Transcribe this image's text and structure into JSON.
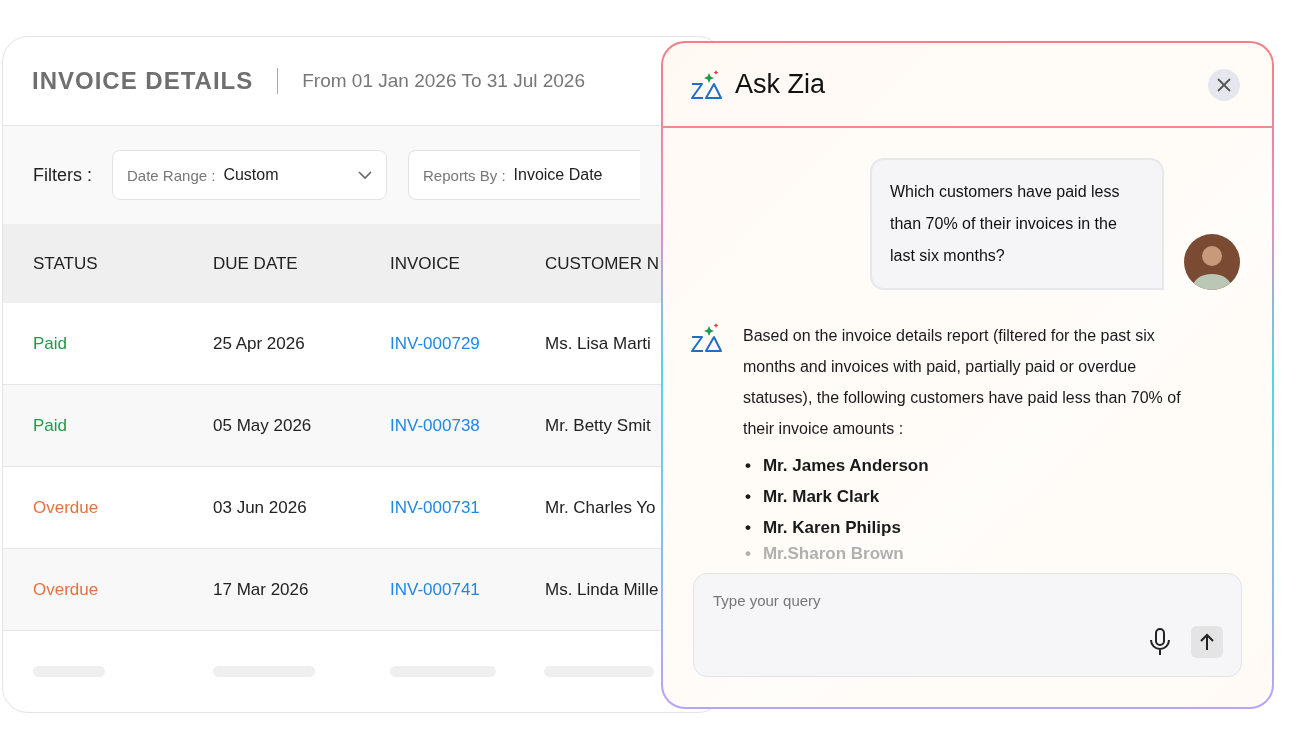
{
  "report": {
    "title": "INVOICE DETAILS",
    "date_range": "From 01 Jan 2026 To 31 Jul 2026",
    "filters_label": "Filters :",
    "filters": [
      {
        "label": "Date Range :",
        "value": "Custom",
        "show_caret": true
      },
      {
        "label": "Reports By :",
        "value": "Invoice  Date",
        "show_caret": false
      }
    ]
  },
  "table": {
    "columns": [
      "STATUS",
      "DUE DATE",
      "INVOICE",
      "CUSTOMER N"
    ],
    "rows": [
      {
        "status": "Paid",
        "color": "#1e9a4a",
        "due_date": "25 Apr 2026",
        "invoice": "INV-000729",
        "customer": "Ms. Lisa Marti"
      },
      {
        "status": "Paid",
        "color": "#1e9a4a",
        "due_date": "05 May 2026",
        "invoice": "INV-000738",
        "customer": "Mr. Betty Smit"
      },
      {
        "status": "Overdue",
        "color": "#e8703f",
        "due_date": "03 Jun 2026",
        "invoice": "INV-000731",
        "customer": "Mr. Charles Yo"
      },
      {
        "status": "Overdue",
        "color": "#e8703f",
        "due_date": "17 Mar 2026",
        "invoice": "INV-000741",
        "customer": "Ms. Linda Mille"
      }
    ]
  },
  "chat": {
    "title": "Ask Zia",
    "messages": [
      {
        "kind": "user",
        "text": "Which customers have paid less than 70% of their invoices in the last six months?"
      },
      {
        "kind": "bot",
        "text": "Based on the invoice details report (filtered for the past six months and invoices with paid, partially paid or overdue statuses), the following customers have paid less than 70% of their invoice amounts :",
        "list": [
          {
            "bullet": "•",
            "text": "Mr. James Anderson",
            "faded": false
          },
          {
            "bullet": "•",
            "text": "Mr. Mark Clark",
            "faded": false
          },
          {
            "bullet": "•",
            "text": "Mr. Karen Philips",
            "faded": false
          },
          {
            "bullet": "•",
            "text": "Mr.Sharon Brown",
            "faded": true
          }
        ]
      }
    ],
    "input": {
      "placeholder": "Type your query"
    }
  }
}
